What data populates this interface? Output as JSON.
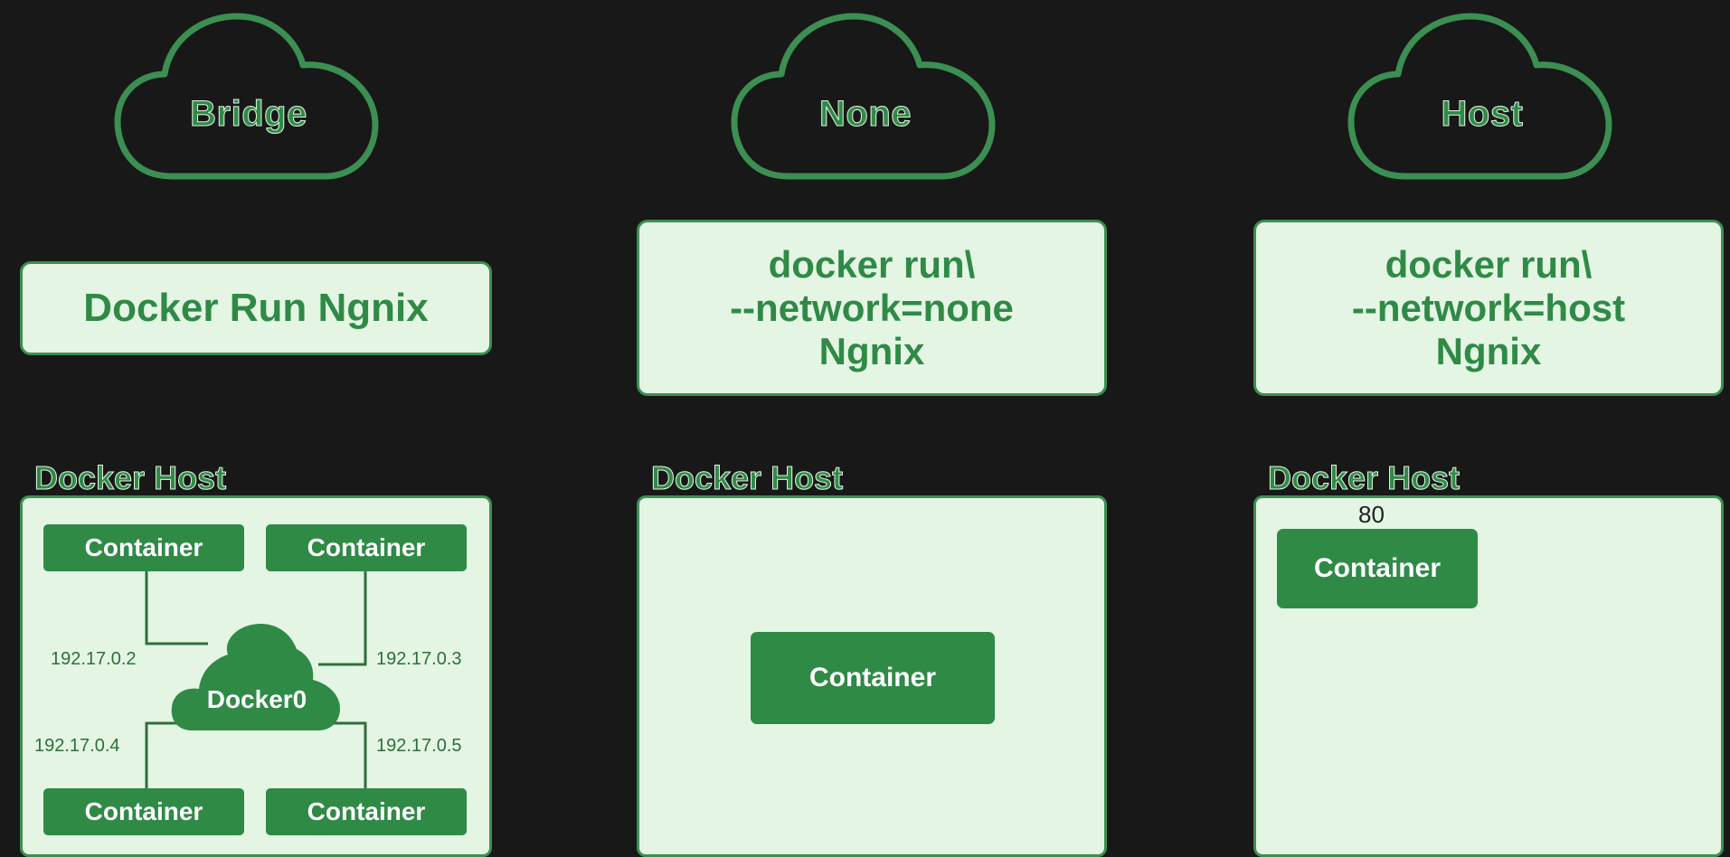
{
  "columns": [
    {
      "network": "Bridge",
      "command": "Docker Run Ngnix",
      "host_label": "Docker Host",
      "containers": [
        "Container",
        "Container",
        "Container",
        "Container"
      ],
      "bridge_label": "Docker0",
      "ips": [
        "192.17.0.2",
        "192.17.0.3",
        "192.17.0.4",
        "192.17.0.5"
      ]
    },
    {
      "network": "None",
      "command_lines": [
        "docker run\\",
        "--network=none",
        "Ngnix"
      ],
      "host_label": "Docker Host",
      "container": "Container"
    },
    {
      "network": "Host",
      "command_lines": [
        "docker run\\",
        "--network=host",
        "Ngnix"
      ],
      "host_label": "Docker Host",
      "port": "80",
      "container": "Container"
    }
  ],
  "colors": {
    "background": "#181818",
    "accent_green": "#2f8a46",
    "panel_fill": "#e4f5e4",
    "panel_border": "#3c8f52"
  }
}
